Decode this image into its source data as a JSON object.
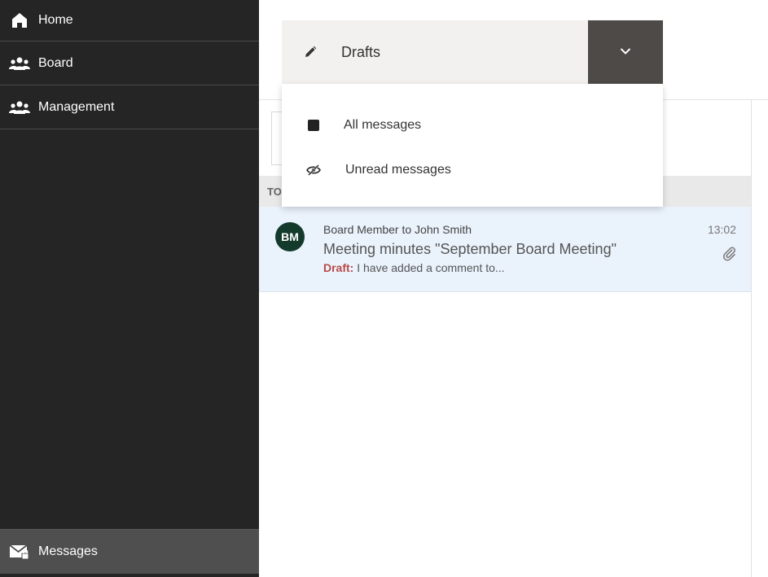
{
  "sidebar": {
    "items": [
      {
        "label": "Home",
        "icon": "home-icon"
      },
      {
        "label": "Board",
        "icon": "people-icon"
      },
      {
        "label": "Management",
        "icon": "people-icon"
      }
    ],
    "messages": {
      "label": "Messages",
      "icon": "mail-lock-icon"
    }
  },
  "folder": {
    "selected": "Drafts",
    "icon": "pencil-icon",
    "toggle_icon": "chevron-down-icon",
    "options": [
      {
        "label": "All messages",
        "icon": "square-icon"
      },
      {
        "label": "Unread messages",
        "icon": "eye-slash-icon"
      }
    ]
  },
  "group": {
    "label": "TO"
  },
  "message": {
    "avatar": "BM",
    "from": "Board Member to John Smith",
    "subject": "Meeting minutes \"September Board Meeting\"",
    "draft_label": "Draft:",
    "preview": " I have added a comment to...",
    "time": "13:02",
    "attachment_icon": "paperclip-icon"
  },
  "colors": {
    "sidebar_bg": "#252525",
    "sidebar_active": "#4f4f4f",
    "avatar_bg": "#143a2c",
    "row_selected": "#eaf2fc",
    "draft_red": "#b94a48",
    "toggle_bg": "#4d4a47"
  }
}
